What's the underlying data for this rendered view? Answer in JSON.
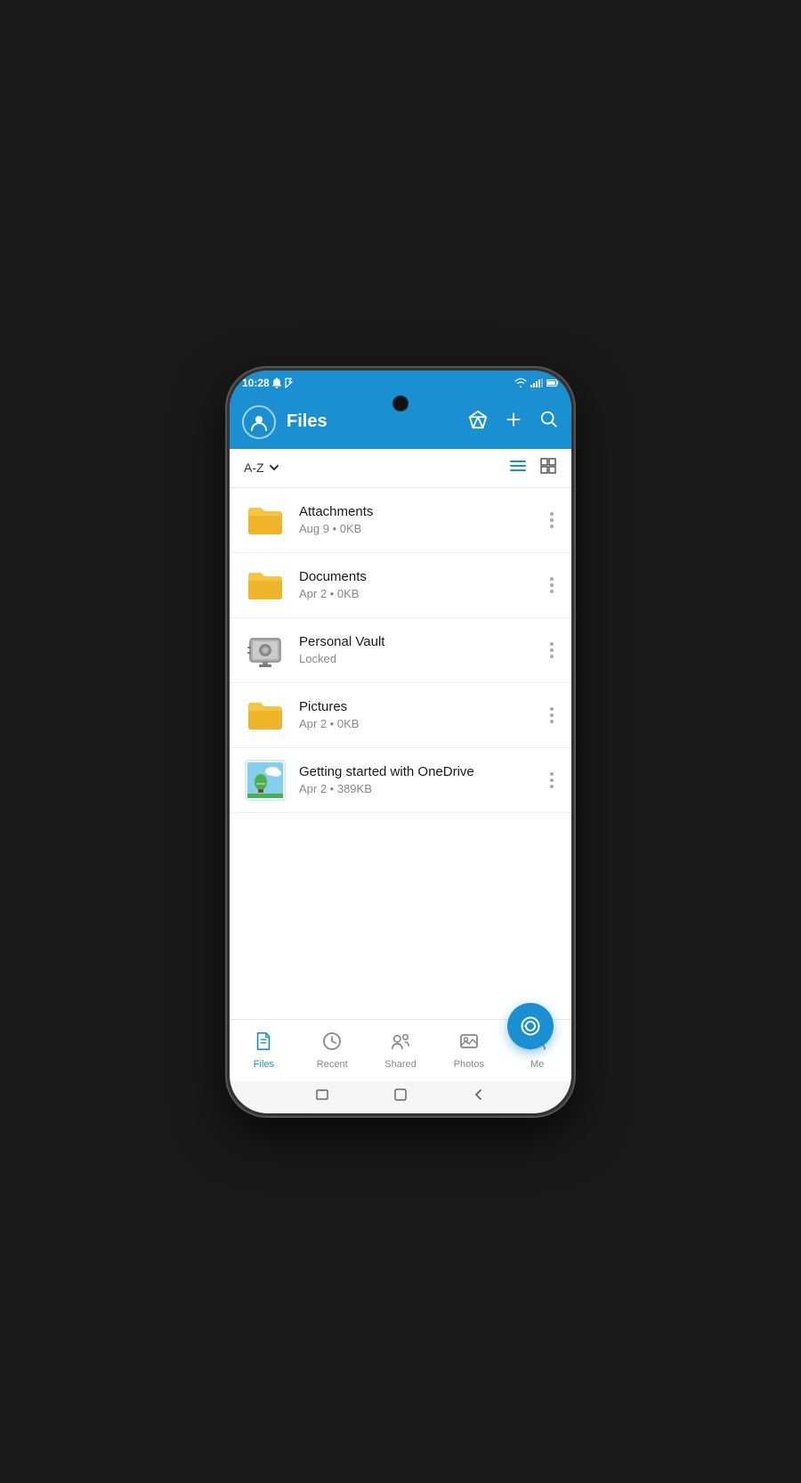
{
  "statusBar": {
    "time": "10:28",
    "icons": [
      "notification1",
      "notification2",
      "cast",
      "usb",
      "nfc",
      "mute",
      "wifi",
      "signal",
      "battery"
    ]
  },
  "header": {
    "title": "Files",
    "avatarIcon": "person-icon",
    "diamondIcon": "premium-icon",
    "addIcon": "add-icon",
    "searchIcon": "search-icon"
  },
  "sortBar": {
    "sortLabel": "A-Z",
    "sortDropdown": "chevron-down-icon",
    "listViewIcon": "list-view-icon",
    "gridViewIcon": "grid-view-icon"
  },
  "files": [
    {
      "name": "Attachments",
      "meta": "Aug 9 • 0KB",
      "type": "folder"
    },
    {
      "name": "Documents",
      "meta": "Apr 2 • 0KB",
      "type": "folder"
    },
    {
      "name": "Personal Vault",
      "meta": "Locked",
      "type": "vault"
    },
    {
      "name": "Pictures",
      "meta": "Apr 2 • 0KB",
      "type": "folder"
    },
    {
      "name": "Getting started with OneDrive",
      "meta": "Apr 2 • 389KB",
      "type": "file"
    }
  ],
  "bottomNav": {
    "items": [
      {
        "label": "Files",
        "icon": "files-icon",
        "active": true
      },
      {
        "label": "Recent",
        "icon": "recent-icon",
        "active": false
      },
      {
        "label": "Shared",
        "icon": "shared-icon",
        "active": false
      },
      {
        "label": "Photos",
        "icon": "photos-icon",
        "active": false
      },
      {
        "label": "Me",
        "icon": "me-icon",
        "active": false
      }
    ]
  },
  "fab": {
    "icon": "camera-icon"
  },
  "systemNav": {
    "back": "◁",
    "home": "○",
    "recents": "▢"
  },
  "colors": {
    "brand": "#1a8fd1",
    "folderYellow": "#F5C542",
    "textPrimary": "#1a1a1a",
    "textSecondary": "#888888"
  }
}
